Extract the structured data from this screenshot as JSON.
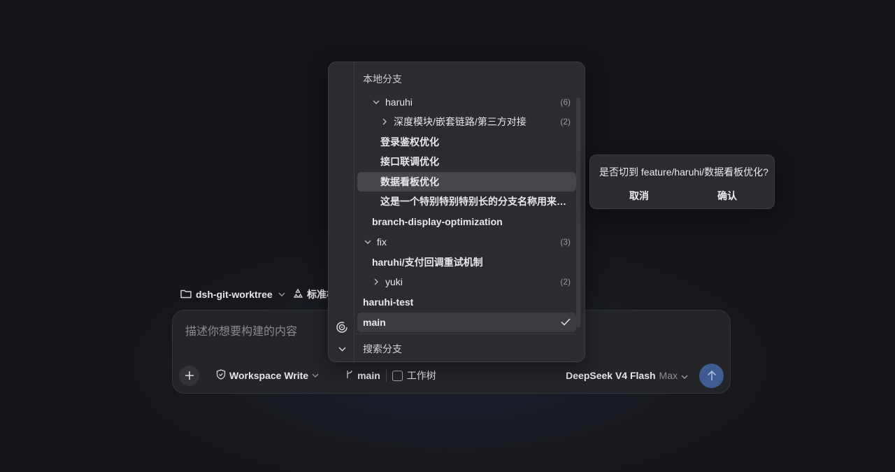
{
  "composer": {
    "repo_name": "dsh-git-worktree",
    "mode_label": "标准模",
    "placeholder": "描述你想要构建的内容",
    "permission_label": "Workspace Write",
    "branch_label": "main",
    "worktree_label": "工作树",
    "model_name": "DeepSeek V4 Flash",
    "model_effort": "Max"
  },
  "branch_menu": {
    "section_title": "本地分支",
    "items": [
      {
        "label": "haruhi",
        "count": "(6)"
      },
      {
        "label": "深度模块/嵌套链路/第三方对接",
        "count": "(2)"
      },
      {
        "label": "登录鉴权优化"
      },
      {
        "label": "接口联调优化"
      },
      {
        "label": "数据看板优化"
      },
      {
        "label": "这是一个特别特别特别长的分支名称用来测试截断显示的效果"
      },
      {
        "label": "branch-display-optimization"
      },
      {
        "label": "fix",
        "count": "(3)"
      },
      {
        "label": "haruhi/支付回调重试机制"
      },
      {
        "label": "yuki",
        "count": "(2)"
      },
      {
        "label": "haruhi-test"
      },
      {
        "label": "main"
      }
    ],
    "search_label": "搜索分支"
  },
  "confirm_popover": {
    "question": "是否切到 feature/haruhi/数据看板优化?",
    "cancel_label": "取消",
    "confirm_label": "确认"
  },
  "colors": {
    "accent": "#3e5b92",
    "panel_bg": "#2b2c30",
    "hover_row": "#46474c"
  },
  "icons": [
    "folder-icon",
    "mode-icon",
    "chevron-down-icon",
    "plus-icon",
    "shield-icon",
    "branch-icon",
    "checkbox-icon",
    "send-arrow-icon",
    "spinner-icon",
    "chevron-right-icon",
    "check-icon"
  ]
}
